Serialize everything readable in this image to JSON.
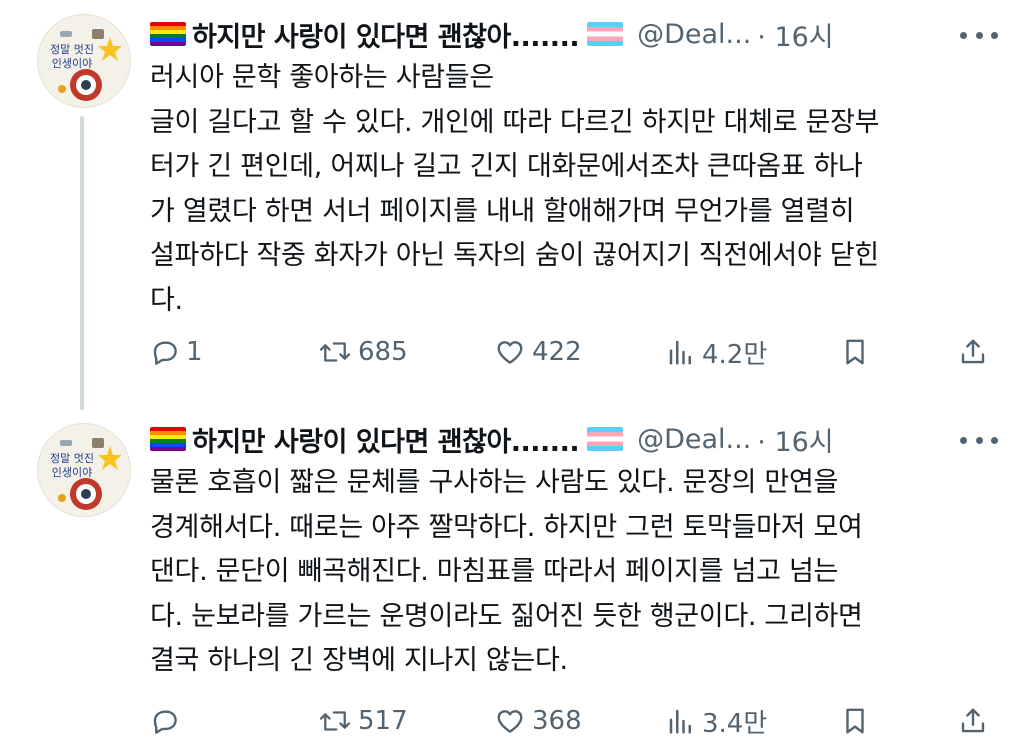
{
  "tweets": [
    {
      "display_name": "하지만 사랑이 있다면 괜찮아.......",
      "handle": "@Deal...",
      "time": "· 16시",
      "avatar_text": [
        "정말 멋진",
        "인생이야"
      ],
      "lines": [
        "러시아 문학 좋아하는 사람들은",
        "글이 길다고 할 수 있다. 개인에 따라 다르긴 하지만 대체로 문장부",
        "터가 긴 편인데, 어찌나 길고 긴지 대화문에서조차 큰따옴표 하나",
        "가 열렸다 하면 서너 페이지를 내내 할애해가며 무언가를 열렬히",
        "설파하다 작중 화자가 아닌 독자의 숨이 끊어지기 직전에서야 닫힌",
        "다."
      ],
      "stats": {
        "replies": "1",
        "retweets": "685",
        "likes": "422",
        "views": "4.2만"
      }
    },
    {
      "display_name": "하지만 사랑이 있다면 괜찮아.......",
      "handle": "@Deal...",
      "time": "· 16시",
      "avatar_text": [
        "정말 멋진",
        "인생이야"
      ],
      "lines": [
        "물론 호흡이 짧은 문체를 구사하는 사람도 있다. 문장의 만연을",
        "경계해서다. 때로는 아주 짤막하다. 하지만 그런 토막들마저 모여",
        "댄다. 문단이 빼곡해진다. 마침표를 따라서 페이지를 넘고 넘는",
        "다. 눈보라를 가르는 운명이라도 짊어진 듯한 행군이다. 그리하면",
        "결국 하나의 긴 장벽에 지나지 않는다."
      ],
      "stats": {
        "replies": "",
        "retweets": "517",
        "likes": "368",
        "views": "3.4만"
      }
    }
  ],
  "icons": [
    "rainbow-flag-icon",
    "trans-flag-icon",
    "more-icon",
    "reply-icon",
    "retweet-icon",
    "like-icon",
    "views-icon",
    "bookmark-icon",
    "share-icon"
  ],
  "colors": {
    "text": "#0f1419",
    "secondary": "#536471",
    "thread_line": "#cfd9de"
  }
}
